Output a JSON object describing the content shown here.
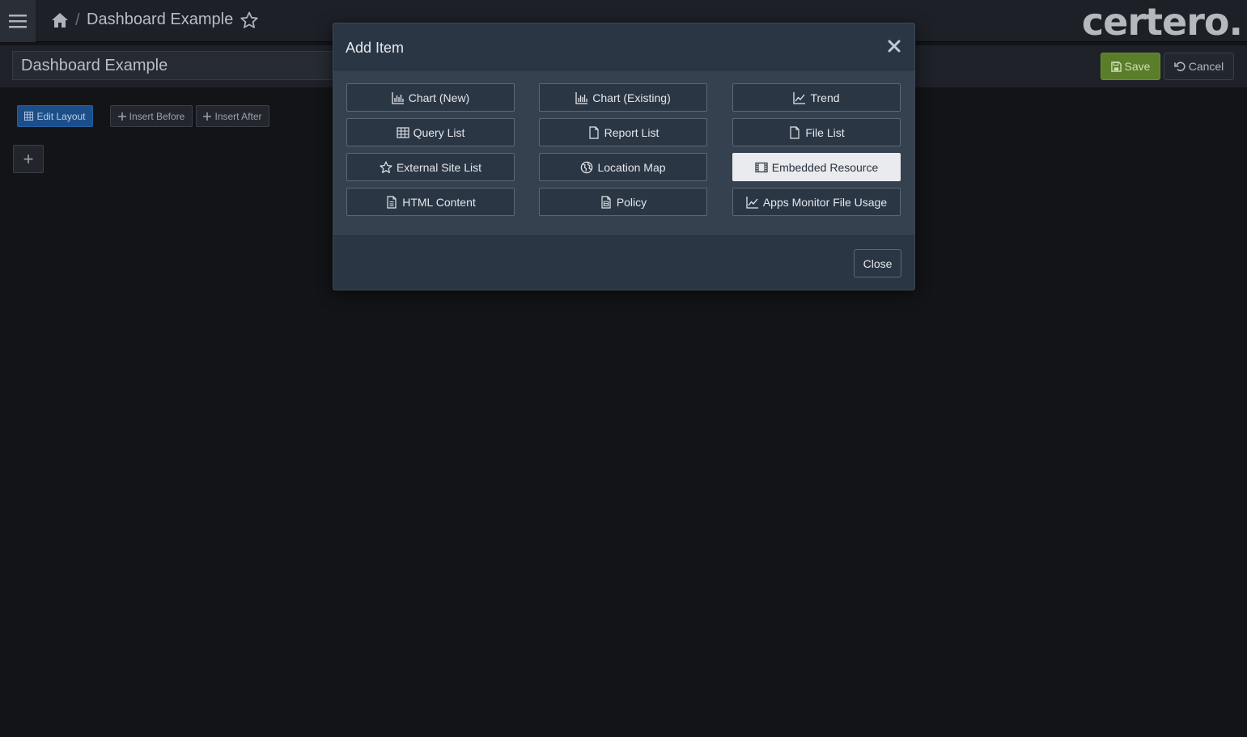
{
  "topbar": {
    "breadcrumb_separator": "/",
    "dashboard_title": "Dashboard Example",
    "logo": "certero."
  },
  "titlebar": {
    "title_value": "Dashboard Example",
    "save_label": "Save",
    "cancel_label": "Cancel",
    "save_color": "#5a7d2a"
  },
  "toolbar": {
    "edit_layout_label": "Edit Layout",
    "insert_before_label": "Insert Before",
    "insert_after_label": "Insert After",
    "add_label": "+"
  },
  "modal": {
    "title": "Add Item",
    "close_label": "Close",
    "items": [
      {
        "label": "Chart (New)",
        "icon": "chart-icon"
      },
      {
        "label": "Chart (Existing)",
        "icon": "chart-icon"
      },
      {
        "label": "Trend",
        "icon": "trend-icon"
      },
      {
        "label": "Query List",
        "icon": "table-icon"
      },
      {
        "label": "Report List",
        "icon": "file-icon"
      },
      {
        "label": "File List",
        "icon": "file-icon"
      },
      {
        "label": "External Site List",
        "icon": "star-icon"
      },
      {
        "label": "Location Map",
        "icon": "globe-icon"
      },
      {
        "label": "Embedded Resource",
        "icon": "film-icon",
        "selected": true
      },
      {
        "label": "HTML Content",
        "icon": "document-icon"
      },
      {
        "label": "Policy",
        "icon": "policy-icon"
      },
      {
        "label": "Apps Monitor File Usage",
        "icon": "trend-icon"
      }
    ]
  }
}
